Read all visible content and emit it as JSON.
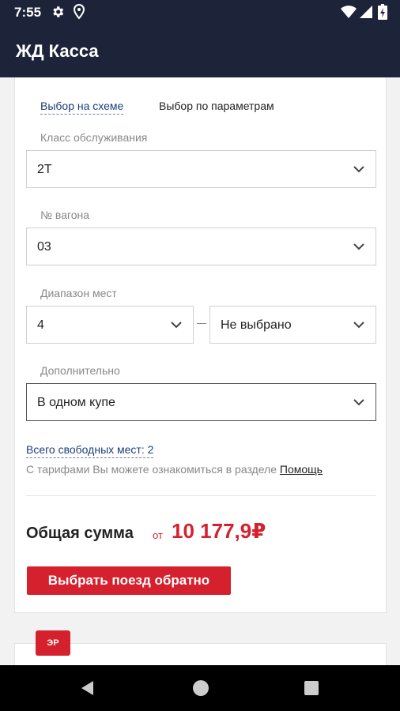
{
  "status_bar": {
    "time": "7:55"
  },
  "app": {
    "title": "ЖД Касса"
  },
  "tabs": [
    {
      "label": "Выбор на схеме"
    },
    {
      "label": "Выбор по параметрам"
    }
  ],
  "fields": {
    "service_class": {
      "label": "Класс обслуживания",
      "value": "2Т"
    },
    "car_number": {
      "label": "№ вагона",
      "value": "03"
    },
    "seat_range": {
      "label": "Диапазон мест",
      "from": "4",
      "to": "Не выбрано"
    },
    "additional": {
      "label": "Дополнительно",
      "value": "В одном купе"
    }
  },
  "free_seats": "Всего свободных мест: 2",
  "tariffs": {
    "text": "С тарифами Вы можете ознакомиться в разделе ",
    "link": "Помощь"
  },
  "total": {
    "label": "Общая сумма",
    "prefix": "от",
    "value": "10 177,9₽"
  },
  "return_button": "Выбрать поезд обратно",
  "badge": "ЭР",
  "colors": {
    "header": "#1d2439",
    "accent": "#d5212e",
    "link": "#1d3d7a"
  },
  "icons": [
    "gear-icon",
    "location-icon",
    "wifi-icon",
    "signal-icon",
    "battery-icon",
    "chevron-down-icon",
    "back-icon",
    "home-icon",
    "recents-icon"
  ]
}
